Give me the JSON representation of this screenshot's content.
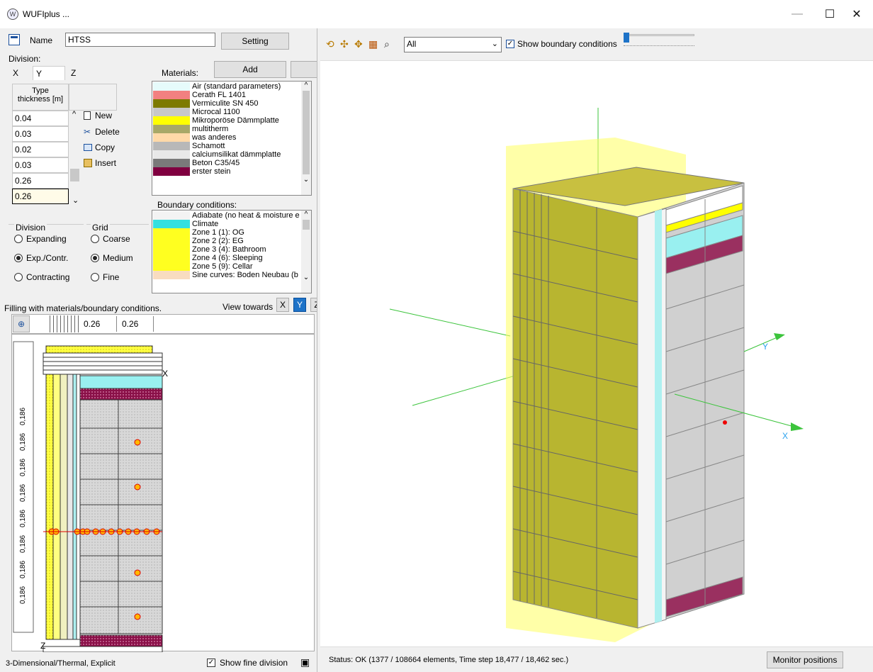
{
  "window": {
    "title": "WUFIplus ...",
    "minimize": "—",
    "maximize": "☐",
    "close": "✕"
  },
  "left": {
    "name_label": "Name",
    "name_value": "HTSS",
    "setting_button": "Setting",
    "division_label": "Division:",
    "tabs": [
      "X",
      "Y",
      "Z"
    ],
    "type_header": "Type",
    "thickness_header": "thickness [m]",
    "thickness_values": [
      "0.04",
      "0.03",
      "0.02",
      "0.03",
      "0.26",
      "0.26"
    ],
    "actions": {
      "new": "New",
      "delete": "Delete",
      "copy": "Copy",
      "insert": "Insert"
    },
    "materials_label": "Materials:",
    "add_button": "Add",
    "materials": [
      {
        "name": "Air (standard parameters)",
        "color": "#e6fbfb"
      },
      {
        "name": "Cerath FL 1401",
        "color": "#f28080"
      },
      {
        "name": "Vermiculite SN 450",
        "color": "#7d7a00"
      },
      {
        "name": "Microcal 1100",
        "color": "#c8c8c8"
      },
      {
        "name": "Mikroporöse Dämmplatte",
        "color": "#ffff00"
      },
      {
        "name": "multitherm",
        "color": "#a8a868"
      },
      {
        "name": "was anderes",
        "color": "#ffd9a8"
      },
      {
        "name": "Schamott",
        "color": "#b8b8b8"
      },
      {
        "name": "calciumsilikat dämmplatte",
        "color": "#e8e8e8"
      },
      {
        "name": "Beton C35/45",
        "color": "#7a7a7a"
      },
      {
        "name": "erster stein",
        "color": "#800040"
      }
    ],
    "boundary_label": "Boundary conditions:",
    "boundaries": [
      {
        "name": "Adiabate (no heat & moisture e",
        "color": "#f3f3f3"
      },
      {
        "name": "Climate",
        "color": "#33e0e0"
      },
      {
        "name": "Zone 1 (1): OG",
        "color": "#ffff20"
      },
      {
        "name": "Zone 2 (2): EG",
        "color": "#ffff20"
      },
      {
        "name": "Zone 3 (4): Bathroom",
        "color": "#ffff20"
      },
      {
        "name": "Zone 4 (6): Sleeping",
        "color": "#ffff20"
      },
      {
        "name": "Zone 5 (9): Cellar",
        "color": "#ffff20"
      },
      {
        "name": "Sine curves: Boden Neubau (b",
        "color": "#f8dcc0"
      }
    ],
    "division_group": "Division",
    "division_options": [
      "Expanding",
      "Exp./Contr.",
      "Contracting"
    ],
    "grid_group": "Grid",
    "grid_options": [
      "Coarse",
      "Medium",
      "Fine"
    ],
    "filling_label": "Filling with materials/boundary conditions.",
    "view_towards": "View towards",
    "view_buttons": [
      "X",
      "Y",
      "Z"
    ],
    "col_headers": [
      "0.26",
      "0.26"
    ],
    "row_labels": [
      "0,186",
      "0,186",
      "0,186",
      "0,186",
      "0,186",
      "0,186",
      "0,186",
      "0,186"
    ],
    "axis_x": "X",
    "axis_z": "Z",
    "mode": "3-Dimensional/Thermal, Explicit",
    "show_fine": "Show fine division"
  },
  "right": {
    "dropdown_value": "All",
    "show_boundary": "Show boundary conditions",
    "axis_x": "X",
    "axis_y": "Y",
    "status": "Status: OK (1377 / 108664 elements, Time step 18,477 / 18,462 sec.)",
    "monitor_button": "Monitor positions"
  }
}
